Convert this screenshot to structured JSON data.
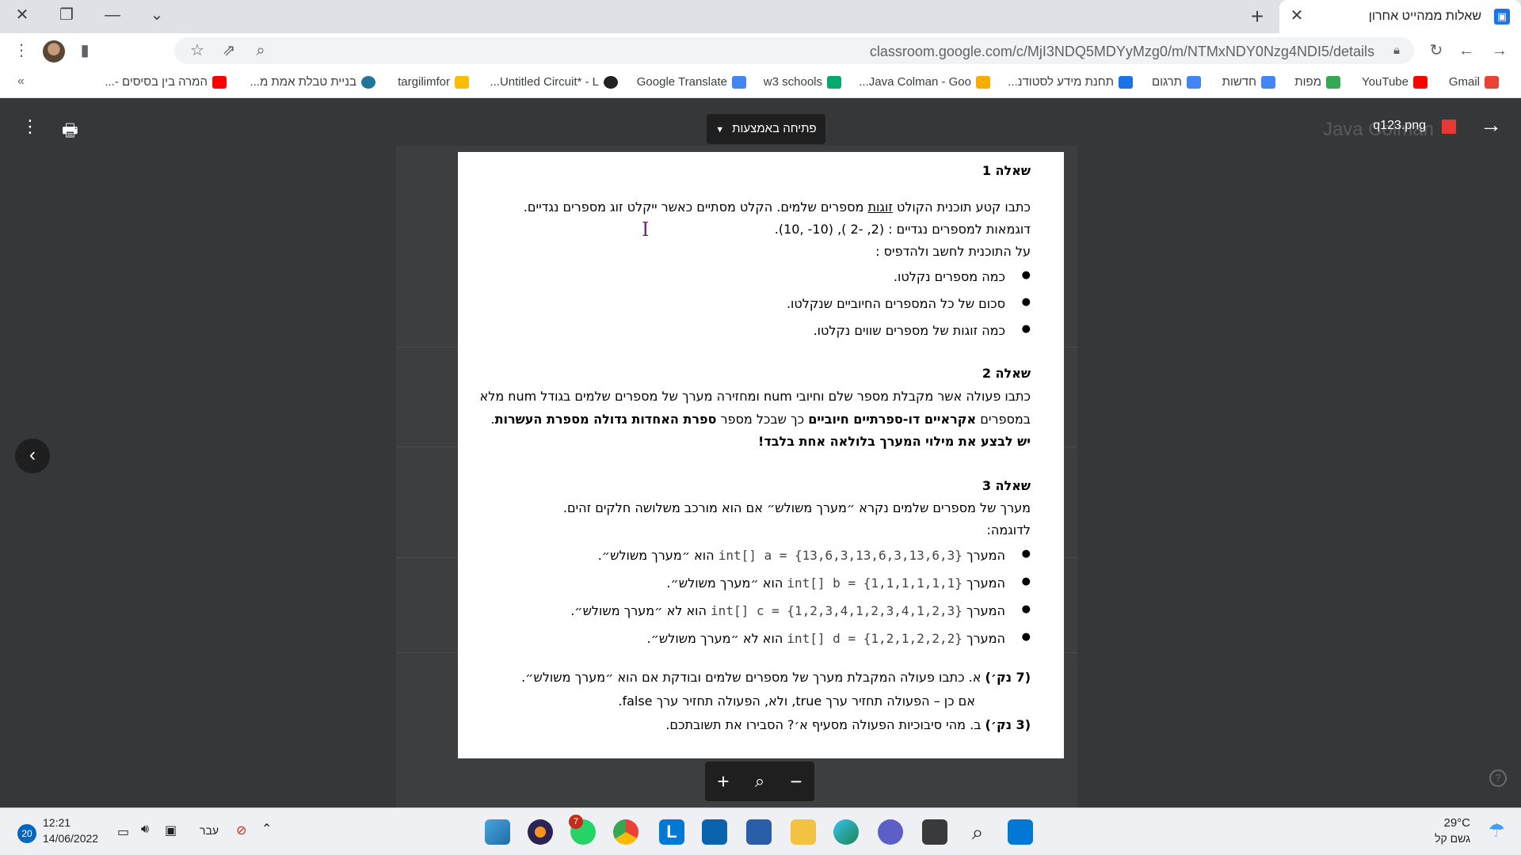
{
  "browser": {
    "tab_title": "שאלות ממהייט אחרון",
    "tab_close": "✕",
    "new_tab": "+",
    "url": "classroom.google.com/c/MjI3NDQ5MDYyMzg0/m/NTMxNDY0Nzg4NDI5/details",
    "bookmarks": [
      {
        "label": "Gmail",
        "color": "#ea4335"
      },
      {
        "label": "YouTube",
        "color": "#ff0000"
      },
      {
        "label": "מפות",
        "color": "#34a853"
      },
      {
        "label": "חדשות",
        "color": "#4285f4"
      },
      {
        "label": "תרגום",
        "color": "#4285f4"
      },
      {
        "label": "תחנת מידע לסטודנ...",
        "color": "#1a73e8"
      },
      {
        "label": "Java Colman - Goo...",
        "color": "#f9ab00"
      },
      {
        "label": "w3 schools",
        "color": "#04aa6d"
      },
      {
        "label": "Google Translate",
        "color": "#4285f4"
      },
      {
        "label": "Untitled Circuit* - L...",
        "color": "#222222"
      },
      {
        "label": "targilimfor",
        "color": "#fbbc04"
      },
      {
        "label": "בניית טבלת אמת מ...",
        "color": "#21759b"
      },
      {
        "label": "המרה בין בסיסים -...",
        "color": "#ff0000"
      }
    ]
  },
  "viewer": {
    "open_with": "פתיחה באמצעות",
    "file_name": "q123.png",
    "bg_title": "Java Colman"
  },
  "doc": {
    "q1_title": "שאלה 1",
    "q1_l1a": "כתבו קטע תוכנית הקולט ",
    "q1_l1u": "זוגות",
    "q1_l1b": " מספרים שלמים. הקלט מסתיים כאשר ייקלט זוג מספרים נגדיים.",
    "q1_l2": "דוגמאות למספרים נגדיים : (2, -2 ), (10- ,10).",
    "q1_l3": "על התוכנית לחשב ולהדפיס :",
    "q1_b1": "כמה מספרים נקלטו.",
    "q1_b2": "סכום של כל המספרים החיוביים שנקלטו.",
    "q1_b3": "כמה זוגות של מספרים שווים נקלטו.",
    "q2_title": "שאלה 2",
    "q2_l1": "כתבו פעולה אשר מקבלת מספר שלם וחיובי num ומחזירה מערך של מספרים שלמים בגודל num מלא",
    "q2_l2a": "במספרים ",
    "q2_l2b": "אקראיים דו-ספרתיים חיוביים",
    "q2_l2c": " כך שבכל מספר ",
    "q2_l2d": "ספרת האחדות גדולה מספרת העשרות",
    "q2_l2e": ".",
    "q2_l3": "יש לבצע את מילוי המערך בלולאה אחת בלבד!",
    "q3_title": "שאלה 3",
    "q3_l1": "מערך של מספרים שלמים נקרא ״מערך משולש״ אם הוא מורכב משלושה חלקים זהים.",
    "q3_l2": "לדוגמה:",
    "q3_prefix": "המערך",
    "q3_ex": [
      {
        "code": "int[] a = {13,6,3,13,6,3,13,6,3}",
        "text": "הוא ״מערך משולש״."
      },
      {
        "code": "int[] b = {1,1,1,1,1,1}",
        "text": "הוא ״מערך משולש״."
      },
      {
        "code": "int[] c = {1,2,3,4,1,2,3,4,1,2,3}",
        "text": "הוא לא ״מערך משולש״."
      },
      {
        "code": "int[] d = {1,2,1,2,2,2}",
        "text": "הוא לא ״מערך משולש״."
      }
    ],
    "q3_a_pts": "(7 נק׳)",
    "q3_a": " א. כתבו פעולה המקבלת מערך של מספרים שלמים ובודקת אם הוא ״מערך משולש״.",
    "q3_a2": "אם כן – הפעולה תחזיר ערך true, ולא, הפעולה תחזיר ערך false.",
    "q3_b_pts": "(3 נק׳)",
    "q3_b": " ב. מהי סיבוכיות הפעולה מסעיף א׳? הסבירו את תשובתכם."
  },
  "taskbar": {
    "weather_temp": "29°C",
    "weather_desc": "גשם קל",
    "time": "12:21",
    "date": "14/06/2022",
    "lang": "עבר",
    "notif_count": "20",
    "whatsapp_badge": "7"
  }
}
